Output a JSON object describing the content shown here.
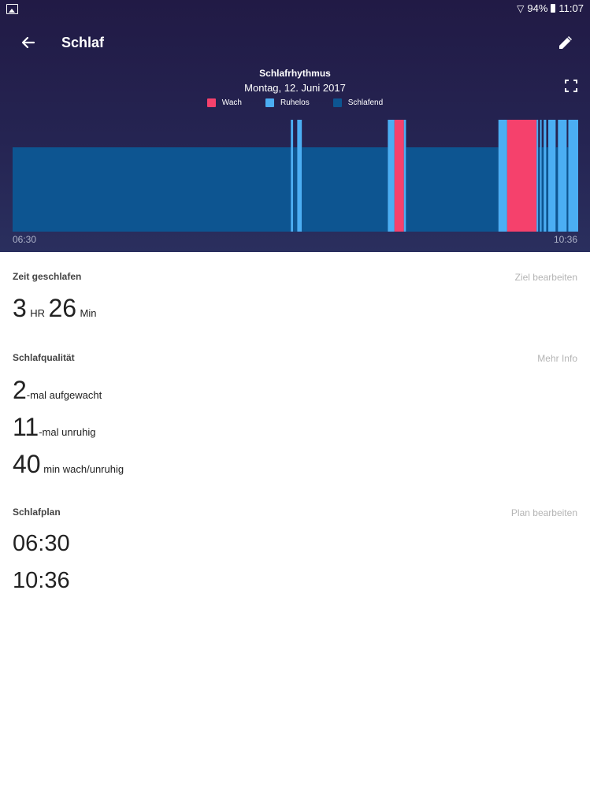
{
  "status_bar": {
    "battery": "94%",
    "time": "11:07",
    "icons": [
      "image-icon",
      "wifi-icon",
      "battery-icon"
    ]
  },
  "toolbar": {
    "title": "Schlaf",
    "back_icon": "arrow-back-icon",
    "edit_icon": "pencil-icon"
  },
  "colors": {
    "header_bg": "#252452",
    "wach": "#f5416c",
    "ruhelos": "#4baef3",
    "schlafend": "#0d5591"
  },
  "chart_data": {
    "type": "timeline",
    "title": "Schlafrhythmus",
    "subtitle": "Montag, 12. Juni 2017",
    "legend": [
      {
        "name": "Wach",
        "color": "#f5416c"
      },
      {
        "name": "Ruhelos",
        "color": "#4baef3"
      },
      {
        "name": "Schlafend",
        "color": "#0d5591"
      }
    ],
    "x_start": "06:30",
    "x_end": "10:36",
    "x_range_minutes": [
      0,
      246
    ],
    "segments": [
      {
        "state": "Schlafend",
        "start": 0,
        "end": 121.0
      },
      {
        "state": "Ruhelos",
        "start": 121.0,
        "end": 122.0
      },
      {
        "state": "Schlafend",
        "start": 122.0,
        "end": 123.8
      },
      {
        "state": "Ruhelos",
        "start": 123.8,
        "end": 125.8
      },
      {
        "state": "Schlafend",
        "start": 125.8,
        "end": 163.2
      },
      {
        "state": "Ruhelos",
        "start": 163.2,
        "end": 166.1
      },
      {
        "state": "Wach",
        "start": 166.1,
        "end": 170.2
      },
      {
        "state": "Ruhelos",
        "start": 170.2,
        "end": 171.1
      },
      {
        "state": "Schlafend",
        "start": 171.1,
        "end": 211.3
      },
      {
        "state": "Ruhelos",
        "start": 211.3,
        "end": 215.1
      },
      {
        "state": "Wach",
        "start": 215.1,
        "end": 227.9
      },
      {
        "state": "Ruhelos",
        "start": 227.9,
        "end": 228.6
      },
      {
        "state": "Schlafend",
        "start": 228.6,
        "end": 229.4
      },
      {
        "state": "Ruhelos",
        "start": 229.4,
        "end": 230.1
      },
      {
        "state": "Schlafend",
        "start": 230.1,
        "end": 231.0
      },
      {
        "state": "Ruhelos",
        "start": 231.0,
        "end": 232.1
      },
      {
        "state": "Schlafend",
        "start": 232.1,
        "end": 233.0
      },
      {
        "state": "Ruhelos",
        "start": 233.0,
        "end": 236.2
      },
      {
        "state": "Schlafend",
        "start": 236.2,
        "end": 237.2
      },
      {
        "state": "Ruhelos",
        "start": 237.2,
        "end": 241.0
      },
      {
        "state": "Schlafend",
        "start": 241.0,
        "end": 241.7
      },
      {
        "state": "Ruhelos",
        "start": 241.7,
        "end": 246.0
      }
    ]
  },
  "expand_icon": "fullscreen-icon",
  "time_asleep": {
    "label": "Zeit geschlafen",
    "link": "Ziel bearbeiten",
    "hours": "3",
    "hours_unit": "HR",
    "minutes": "26",
    "minutes_unit": "Min"
  },
  "quality": {
    "label": "Schlafqualität",
    "link": "Mehr Info",
    "rows": [
      {
        "value": "2",
        "text": "-mal aufgewacht"
      },
      {
        "value": "11",
        "text": "-mal unruhig"
      },
      {
        "value": "40",
        "text": " min wach/unruhig"
      }
    ]
  },
  "plan": {
    "label": "Schlafplan",
    "link": "Plan bearbeiten",
    "start": "06:30",
    "end": "10:36"
  }
}
